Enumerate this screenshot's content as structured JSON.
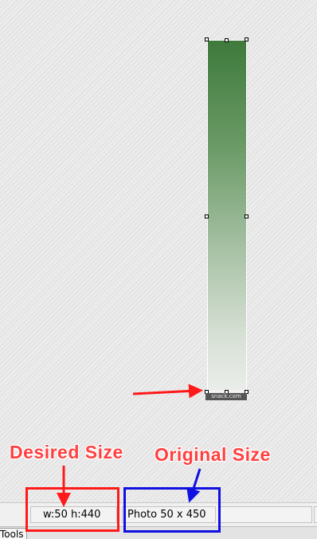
{
  "canvas": {
    "image_watermark": "snack.com"
  },
  "annotations": {
    "desired_label": "Desired Size",
    "original_label": "Original Size",
    "colors": {
      "red": "#ff1a1a",
      "blue": "#1010e0",
      "label_red": "#ff4040"
    }
  },
  "statusbar": {
    "dimensions_text": "w:50 h:440",
    "photo_text": "Photo 50 x 450"
  },
  "tabs": {
    "tools_label": "Tools"
  }
}
